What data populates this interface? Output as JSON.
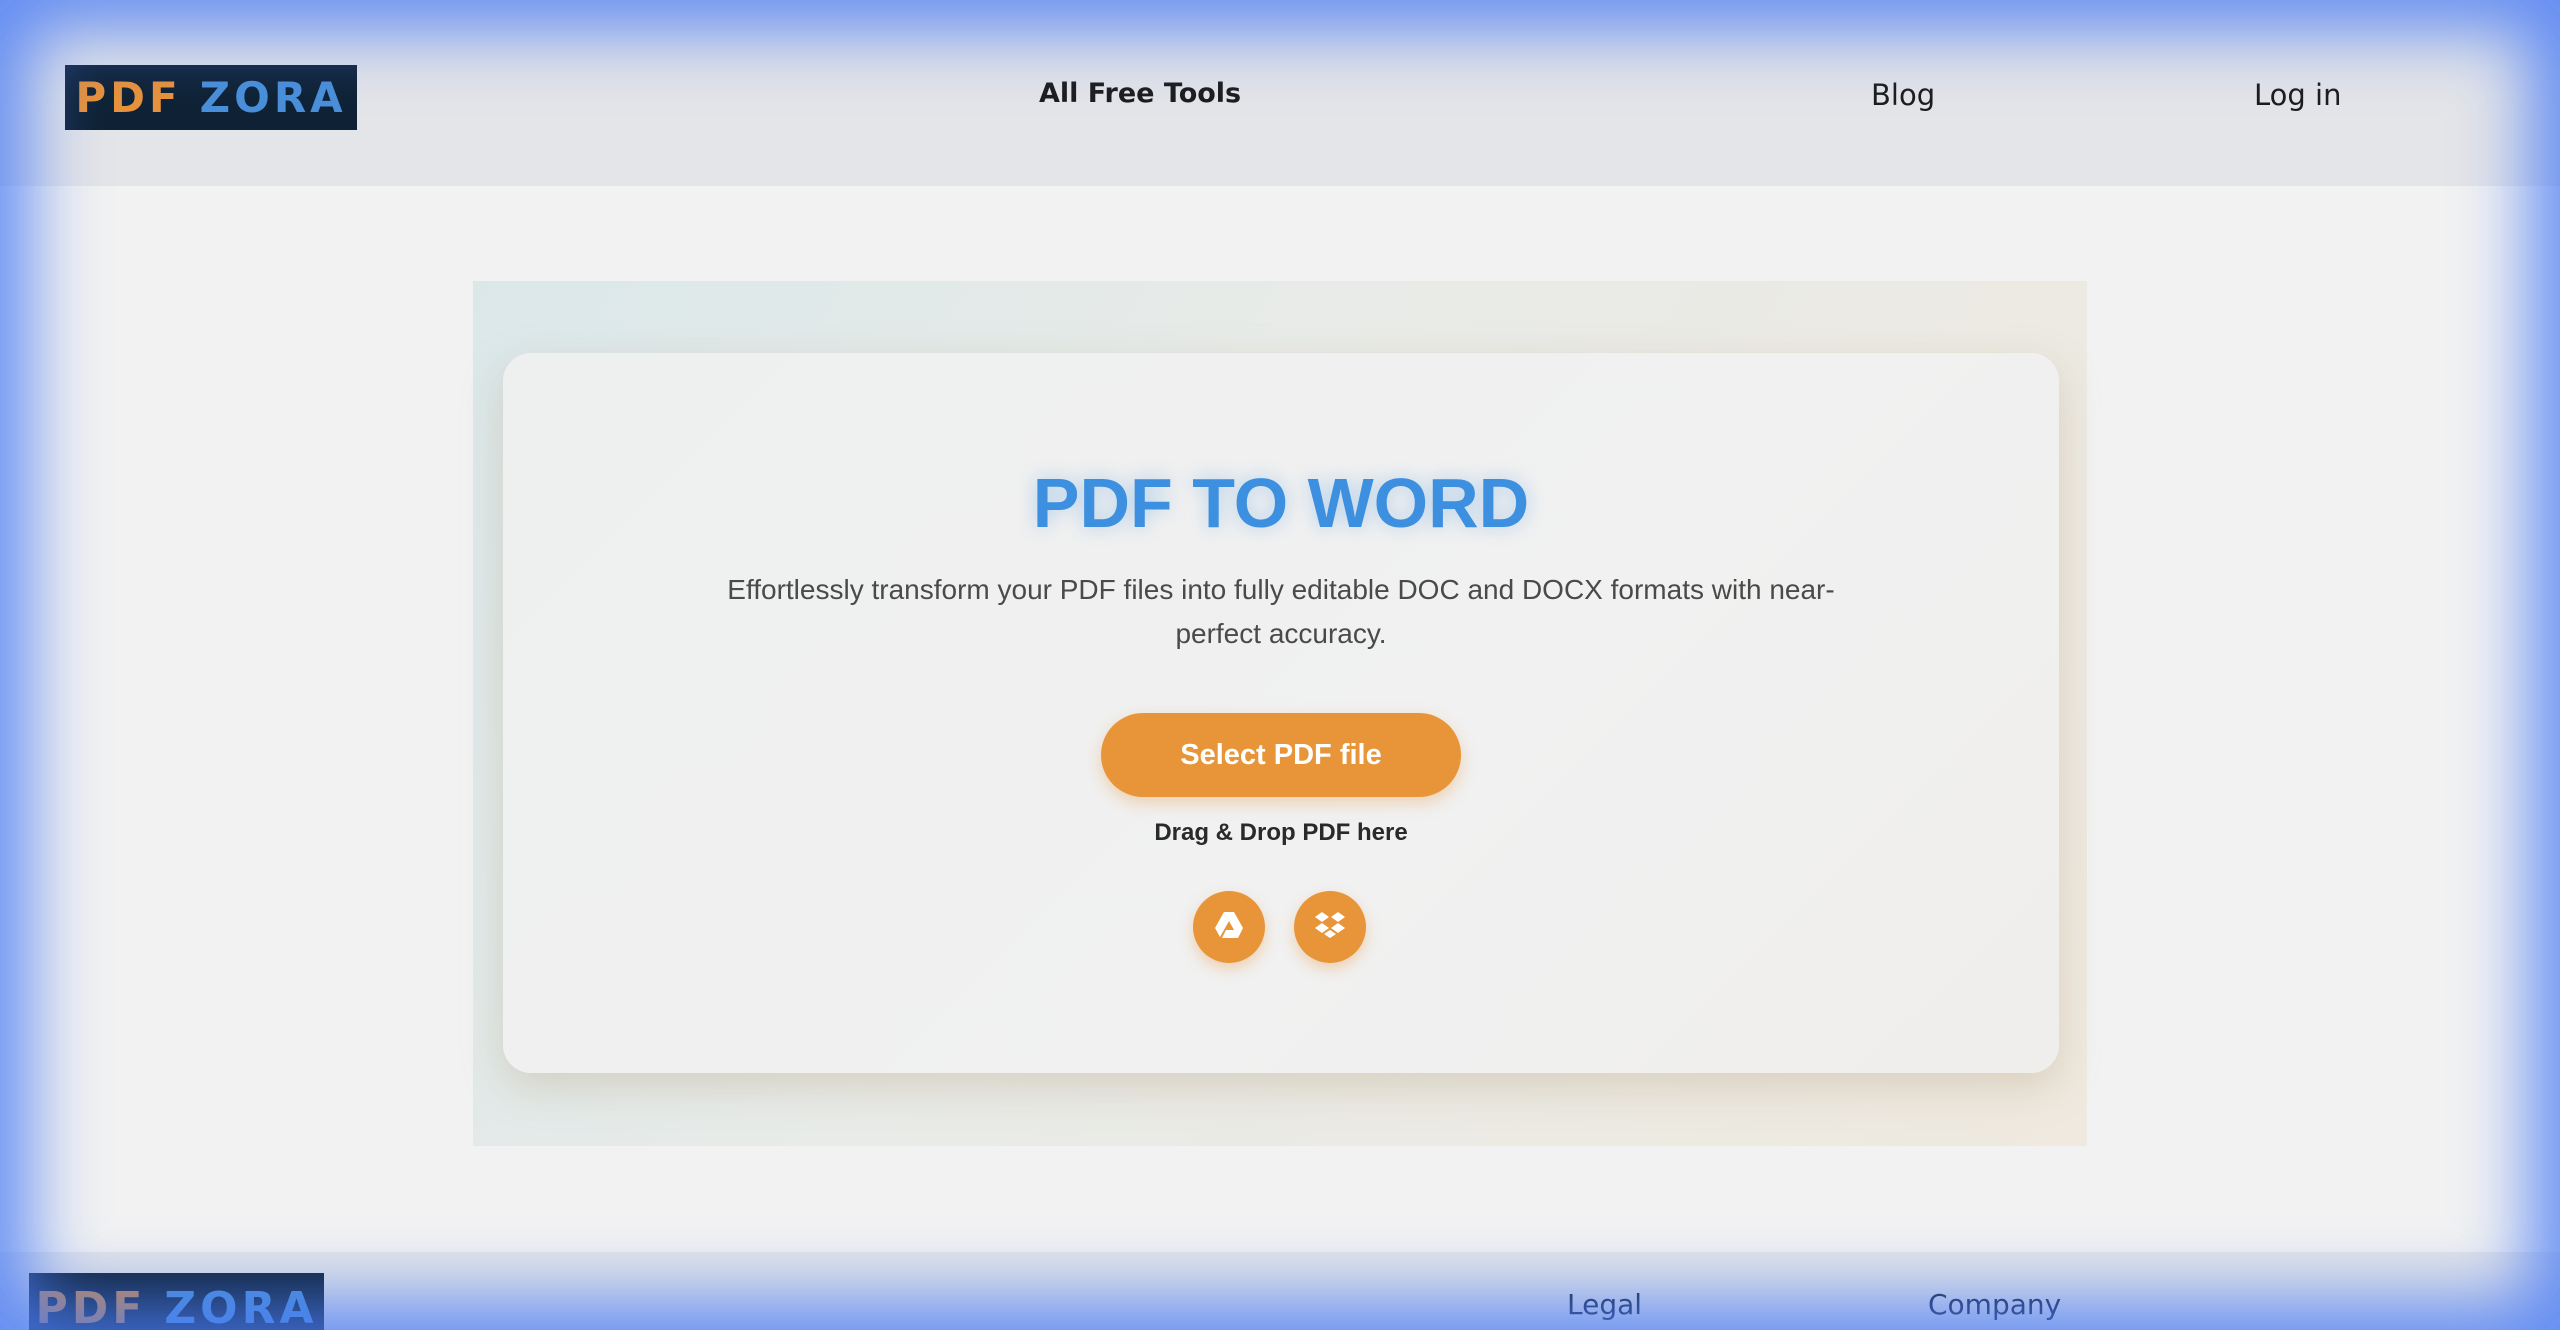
{
  "header": {
    "logo": {
      "part1": "PDF",
      "part2": "ZORA"
    },
    "nav": {
      "tools": "All Free Tools",
      "blog": "Blog",
      "login": "Log in"
    }
  },
  "hero": {
    "title": "PDF TO WORD",
    "description": "Effortlessly transform your PDF files into fully editable DOC and DOCX formats with near-perfect accuracy.",
    "select_button": "Select PDF file",
    "drag_text": "Drag & Drop PDF here",
    "cloud_buttons": [
      {
        "icon": "google-drive-icon"
      },
      {
        "icon": "dropbox-icon"
      }
    ]
  },
  "footer": {
    "logo": {
      "part1": "PDF",
      "part2": "ZORA"
    },
    "headings": {
      "legal": "Legal",
      "company": "Company"
    }
  },
  "colors": {
    "accent_orange": "#e8953a",
    "title_blue": "#3d8fe0",
    "logo_bg": "#0f2235",
    "frame_blue": "#4b7df5"
  }
}
